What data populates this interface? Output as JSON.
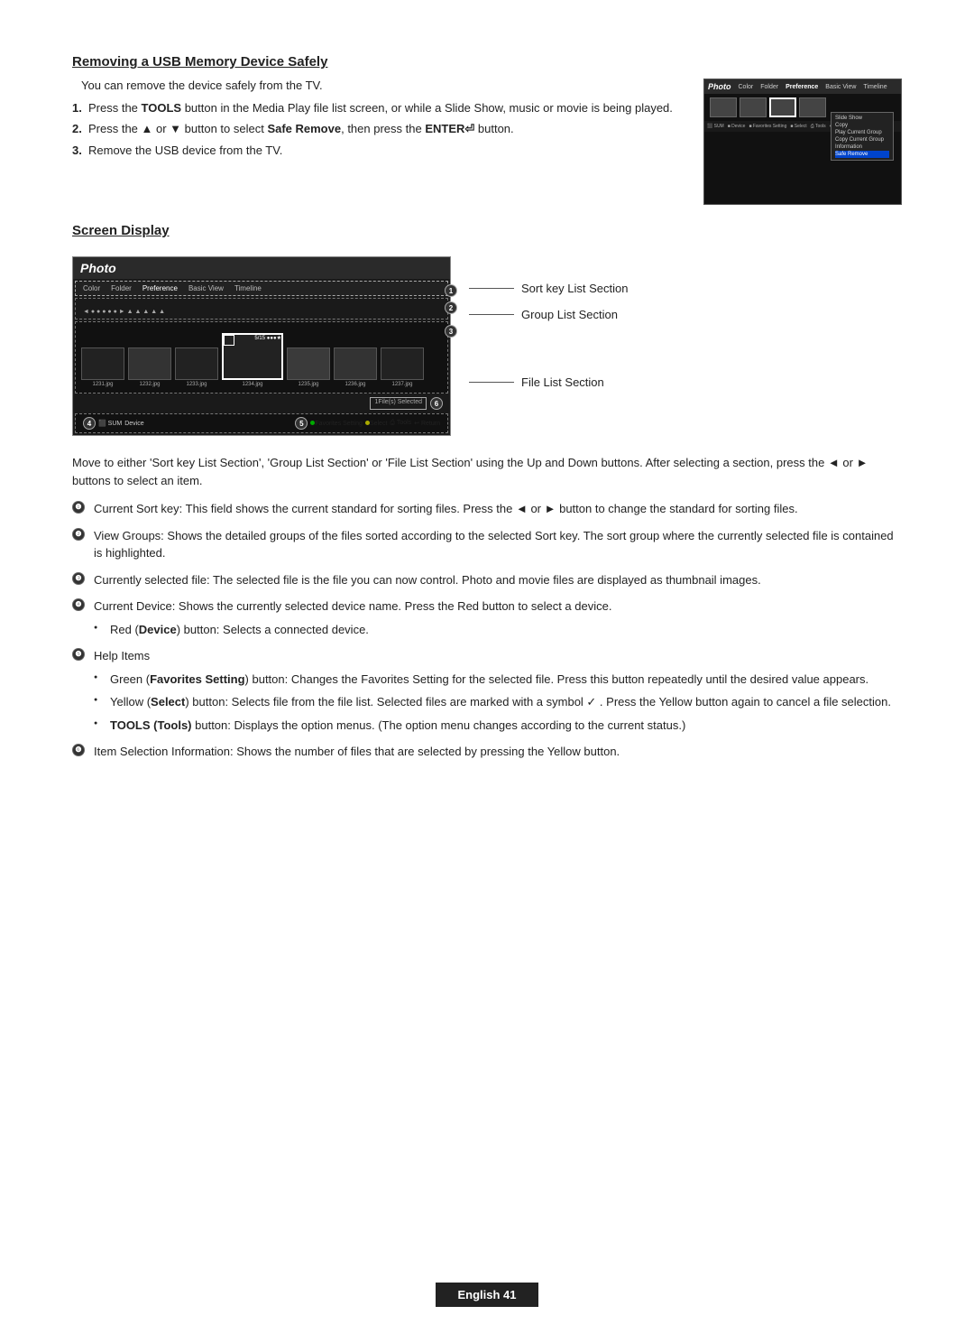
{
  "page": {
    "title": "Removing a USB Memory Device Safely",
    "screen_display_title": "Screen Display",
    "footer": "English 41"
  },
  "usb_section": {
    "title": "Removing a USB Memory Device Safely",
    "intro": "You can remove the device safely from the TV.",
    "steps": [
      {
        "num": "1.",
        "text_plain": "Press the ",
        "bold": "TOOLS",
        "text_after": " button in the Media Play file list screen, or while a Slide Show, music or movie is being played."
      },
      {
        "num": "2.",
        "text_before": "Press the ▲ or ▼ button to select ",
        "bold": "Safe Remove",
        "text_middle": ", then press the ",
        "bold2": "ENTER",
        "text_after": " button."
      },
      {
        "num": "3.",
        "text": "Remove the USB device from the TV."
      }
    ]
  },
  "screen_display": {
    "title": "Screen Display",
    "mock": {
      "app_name": "Photo",
      "nav_items": [
        "Color",
        "Folder",
        "Preference",
        "Basic View",
        "Timeline"
      ],
      "files": [
        {
          "name": "1231.jpg"
        },
        {
          "name": "1232.jpg"
        },
        {
          "name": "1233.jpg"
        },
        {
          "name": "1234.jpg",
          "selected": true
        },
        {
          "name": "1235.jpg"
        },
        {
          "name": "1236.jpg"
        },
        {
          "name": "1237.jpg"
        }
      ],
      "status": "1File(s) Selected",
      "counter": "5/15 ●●●★",
      "bottom_items": [
        "SUM",
        "Device",
        "Favorites Setting",
        "Select",
        "Tools",
        "Return"
      ]
    },
    "labels": [
      {
        "num": "1",
        "text": "Sort key List Section"
      },
      {
        "num": "2",
        "text": "Group List Section"
      },
      {
        "num": "3",
        "text": "File List Section"
      }
    ],
    "annotations": [
      {
        "num": "1",
        "position": "nav"
      },
      {
        "num": "2",
        "position": "group"
      },
      {
        "num": "3",
        "position": "files"
      },
      {
        "num": "4",
        "position": "device"
      },
      {
        "num": "5",
        "position": "help"
      },
      {
        "num": "6",
        "position": "selection"
      }
    ]
  },
  "descriptions": {
    "intro": "Move to either 'Sort key List Section', 'Group List Section' or 'File List Section' using the Up and Down buttons. After selecting a section, press the ◄ or ► buttons to select an item.",
    "items": [
      {
        "num": "1",
        "text": "Current Sort key: This field shows the current standard for sorting files. Press the ◄ or ► button to change the standard for sorting files."
      },
      {
        "num": "2",
        "text": "View Groups: Shows the detailed groups of the files sorted according to the selected Sort key. The sort group where the currently selected file is contained is highlighted."
      },
      {
        "num": "3",
        "text": "Currently selected file: The selected file is the file you can now control. Photo and movie files are displayed as thumbnail images."
      },
      {
        "num": "4",
        "text": "Current Device: Shows the currently selected device name. Press the Red button to select a device.",
        "sub_items": [
          "Red (Device) button: Selects a connected device."
        ]
      },
      {
        "num": "5",
        "text": "Help Items",
        "sub_items": [
          "Green (Favorites Setting) button: Changes the Favorites Setting for the selected file. Press this button repeatedly until the desired value appears.",
          "Yellow (Select) button: Selects file from the file list. Selected files are marked with a symbol ✓ . Press the Yellow button again to cancel a file selection.",
          "TOOLS (Tools) button: Displays the option menus. (The option menu changes according to the current status.)"
        ]
      },
      {
        "num": "6",
        "text": "Item Selection Information: Shows the number of files that are selected by pressing the Yellow button."
      }
    ]
  }
}
